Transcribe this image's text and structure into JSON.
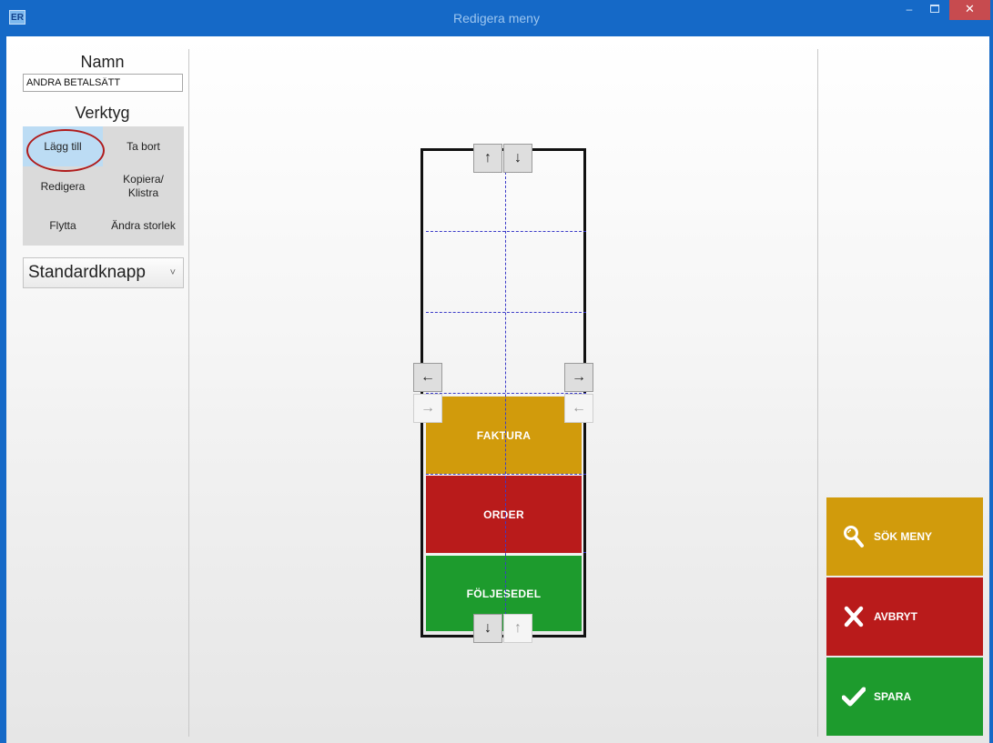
{
  "window": {
    "app_icon": "ER",
    "title": "Redigera meny",
    "minimize_glyph": "–",
    "close_glyph": "✕"
  },
  "left_panel": {
    "name_label": "Namn",
    "name_value": "ANDRA BETALSÄTT",
    "tools_label": "Verktyg",
    "tools": {
      "add": "Lägg till",
      "remove": "Ta bort",
      "edit": "Redigera",
      "copy_paste": "Kopiera/\nKlistra",
      "move": "Flytta",
      "resize": "Ändra storlek"
    },
    "button_type": "Standardknapp",
    "button_type_chevron": "˅"
  },
  "menu_editor": {
    "items": [
      {
        "label": "FAKTURA",
        "color": "#d19b0c"
      },
      {
        "label": "ORDER",
        "color": "#b91b1b"
      },
      {
        "label": "FÖLJESEDEL",
        "color": "#1d9b2d"
      }
    ],
    "arrows": {
      "up": "↑",
      "down": "↓",
      "left": "←",
      "right": "→"
    }
  },
  "actions": {
    "search": {
      "label": "SÖK MENY",
      "icon": "search-icon",
      "color": "#d19b0c"
    },
    "cancel": {
      "label": "AVBRYT",
      "icon": "x-icon",
      "color": "#b91b1b"
    },
    "save": {
      "label": "SPARA",
      "icon": "checkmark-icon",
      "color": "#1d9b2d"
    }
  },
  "colors": {
    "titlebar": "#1569c7",
    "selection": "#bcdcf4",
    "highlight_ring": "#b01c1c"
  }
}
